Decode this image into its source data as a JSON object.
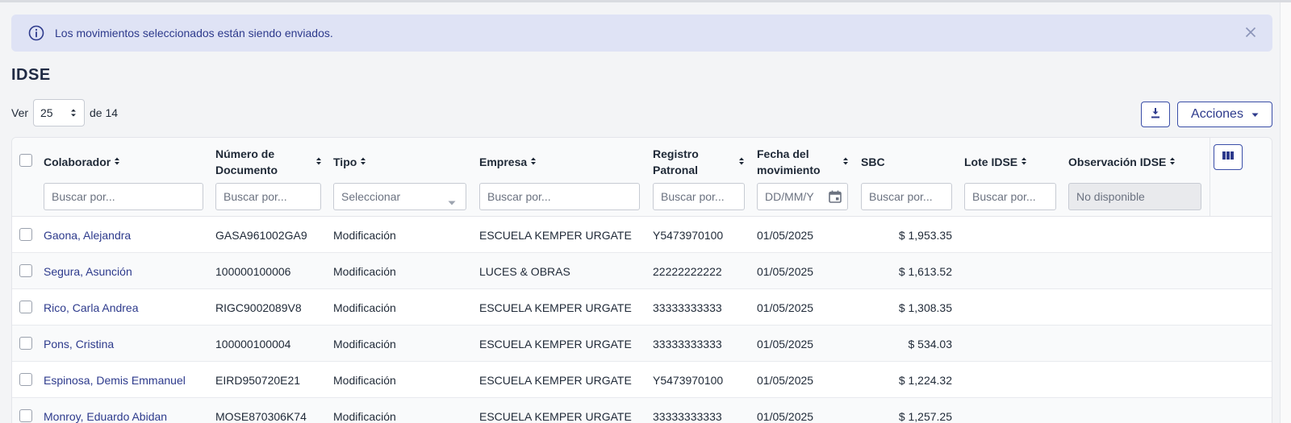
{
  "alert": {
    "message": "Los movimientos seleccionados están siendo enviados.",
    "info_icon": "info-circle-icon",
    "close_icon": "close-icon"
  },
  "page": {
    "title": "IDSE"
  },
  "pager": {
    "prefix": "Ver",
    "page_size": "25",
    "suffix": "de 14"
  },
  "toolbar": {
    "download_icon": "download-icon",
    "actions_label": "Acciones"
  },
  "table": {
    "columns": [
      {
        "label": "Colaborador",
        "line2": ""
      },
      {
        "label": "Número de",
        "line2": "Documento"
      },
      {
        "label": "Tipo",
        "line2": ""
      },
      {
        "label": "Empresa",
        "line2": ""
      },
      {
        "label": "Registro",
        "line2": "Patronal"
      },
      {
        "label": "Fecha del",
        "line2": "movimiento"
      },
      {
        "label": "SBC",
        "line2": ""
      },
      {
        "label": "Lote IDSE",
        "line2": ""
      },
      {
        "label": "Observación IDSE",
        "line2": ""
      }
    ],
    "filters": {
      "colaborador": "Buscar por...",
      "documento": "Buscar por...",
      "tipo": "Seleccionar",
      "empresa": "Buscar por...",
      "registro": "Buscar por...",
      "fecha": "DD/MM/Y",
      "sbc": "Buscar por...",
      "lote": "Buscar por...",
      "observacion": "No disponible"
    },
    "rows": [
      {
        "colaborador": "Gaona, Alejandra",
        "documento": "GASA961002GA9",
        "tipo": "Modificación",
        "empresa": "ESCUELA KEMPER URGATE",
        "registro": "Y5473970100",
        "fecha": "01/05/2025",
        "sbc": "$ 1,953.35"
      },
      {
        "colaborador": "Segura, Asunción",
        "documento": "100000100006",
        "tipo": "Modificación",
        "empresa": "LUCES & OBRAS",
        "registro": "22222222222",
        "fecha": "01/05/2025",
        "sbc": "$ 1,613.52"
      },
      {
        "colaborador": "Rico, Carla Andrea",
        "documento": "RIGC9002089V8",
        "tipo": "Modificación",
        "empresa": "ESCUELA KEMPER URGATE",
        "registro": "33333333333",
        "fecha": "01/05/2025",
        "sbc": "$ 1,308.35"
      },
      {
        "colaborador": "Pons, Cristina",
        "documento": "100000100004",
        "tipo": "Modificación",
        "empresa": "ESCUELA KEMPER URGATE",
        "registro": "33333333333",
        "fecha": "01/05/2025",
        "sbc": "$ 534.03"
      },
      {
        "colaborador": "Espinosa, Demis Emmanuel",
        "documento": "EIRD950720E21",
        "tipo": "Modificación",
        "empresa": "ESCUELA KEMPER URGATE",
        "registro": "Y5473970100",
        "fecha": "01/05/2025",
        "sbc": "$ 1,224.32"
      },
      {
        "colaborador": "Monroy, Eduardo Abidan",
        "documento": "MOSE870306K74",
        "tipo": "Modificación",
        "empresa": "ESCUELA KEMPER URGATE",
        "registro": "33333333333",
        "fecha": "01/05/2025",
        "sbc": "$ 1,257.25"
      }
    ]
  },
  "colors": {
    "accent": "#2d3a8c",
    "alert_bg": "#dfe3f5",
    "border": "#c7cbd3"
  }
}
